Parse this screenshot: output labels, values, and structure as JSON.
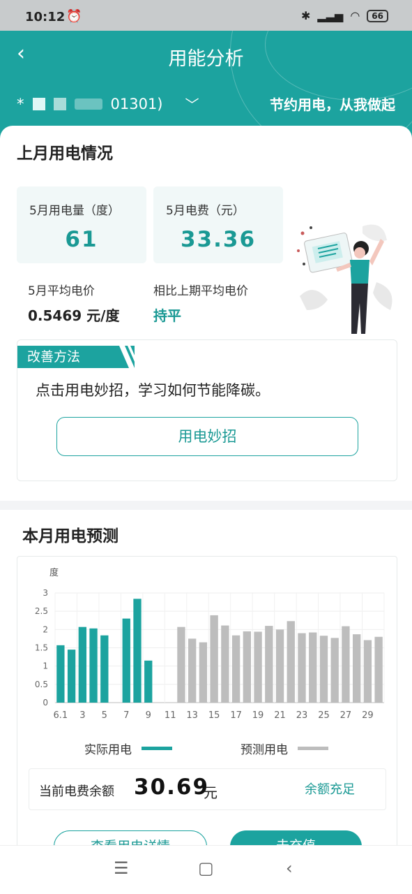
{
  "status_bar": {
    "time": "10:12",
    "battery": "66"
  },
  "header": {
    "title": "用能分析",
    "account_text": "01301)",
    "slogan": "节约用电，从我做起"
  },
  "last_month": {
    "section_title": "上月用电情况",
    "usage_label": "5月用电量（度）",
    "usage_value": "61",
    "fee_label": "5月电费（元）",
    "fee_value": "33.36",
    "avg_price_label": "5月平均电价",
    "avg_price_value": "0.5469 元/度",
    "compare_label": "相比上期平均电价",
    "compare_value": "持平"
  },
  "improve": {
    "tag": "改善方法",
    "desc": "点击用电妙招，学习如何节能降碳。",
    "button": "用电妙招"
  },
  "forecast": {
    "section_title": "本月用电预测",
    "legend_actual": "实际用电",
    "legend_forecast": "预测用电",
    "balance_label": "当前电费余额",
    "balance_value": "30.69",
    "balance_unit": "元",
    "balance_status": "余额充足",
    "btn_detail": "查看用电详情",
    "btn_recharge": "去充值"
  },
  "colors": {
    "accent": "#1ca39f",
    "forecast_bar": "#bdbdbd"
  },
  "chart_data": {
    "type": "bar",
    "ylabel": "度",
    "ylim": [
      0,
      3
    ],
    "yticks": [
      "3",
      "2.5",
      "2",
      "1.5",
      "1",
      "0.5",
      "0"
    ],
    "xtick_labels": [
      "6.1",
      "3",
      "5",
      "7",
      "9",
      "11",
      "13",
      "15",
      "17",
      "19",
      "21",
      "23",
      "25",
      "27",
      "29"
    ],
    "grid": true,
    "series": [
      {
        "name": "实际用电",
        "color": "#1ca39f",
        "values": [
          1.57,
          1.45,
          2.07,
          2.03,
          1.84,
          null,
          2.3,
          2.84,
          1.15,
          null,
          null,
          null,
          null,
          null,
          null,
          null,
          null,
          null,
          null,
          null,
          null,
          null,
          null,
          null,
          null,
          null,
          null,
          null,
          null,
          null
        ]
      },
      {
        "name": "预测用电",
        "color": "#bdbdbd",
        "values": [
          null,
          null,
          null,
          null,
          null,
          null,
          null,
          null,
          null,
          null,
          null,
          2.07,
          1.75,
          1.65,
          2.39,
          2.11,
          1.84,
          1.95,
          1.94,
          2.1,
          2.0,
          2.23,
          1.9,
          1.92,
          1.83,
          1.77,
          2.09,
          1.87,
          1.71,
          1.8
        ]
      }
    ]
  }
}
